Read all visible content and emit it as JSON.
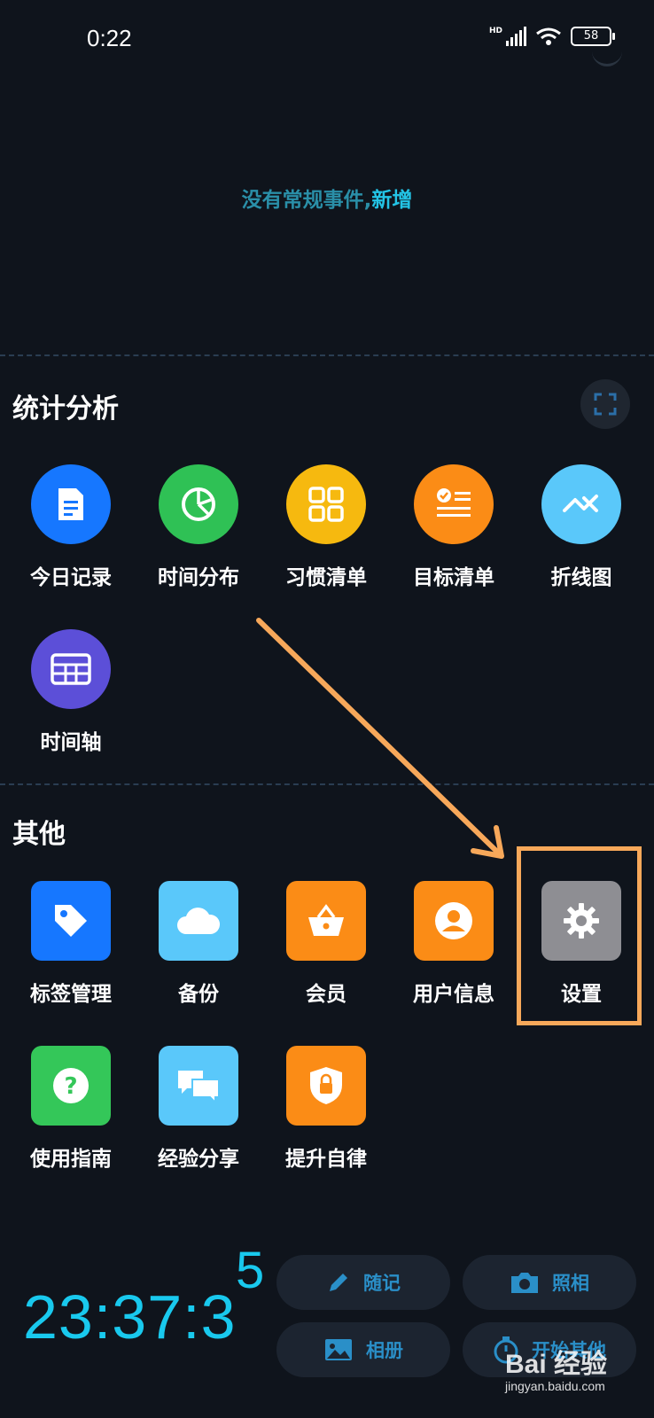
{
  "status": {
    "time": "0:22",
    "battery": "58",
    "network": "HD"
  },
  "routine": {
    "empty_text": "没有常规事件,",
    "add_link": "新增"
  },
  "stats": {
    "title": "统计分析",
    "items": [
      {
        "label": "今日记录",
        "icon": "document-icon",
        "color": "#1677ff"
      },
      {
        "label": "时间分布",
        "icon": "pie-chart-icon",
        "color": "#2fc155"
      },
      {
        "label": "习惯清单",
        "icon": "grid-icon",
        "color": "#f6b90f"
      },
      {
        "label": "目标清单",
        "icon": "checklist-icon",
        "color": "#fb8c16"
      },
      {
        "label": "折线图",
        "icon": "line-chart-icon",
        "color": "#5ac8fa"
      },
      {
        "label": "时间轴",
        "icon": "table-icon",
        "color": "#5c4fd8"
      }
    ]
  },
  "others": {
    "title": "其他",
    "items": [
      {
        "label": "标签管理",
        "icon": "tag-icon",
        "color": "#1677ff"
      },
      {
        "label": "备份",
        "icon": "cloud-icon",
        "color": "#5ac8fa"
      },
      {
        "label": "会员",
        "icon": "basket-icon",
        "color": "#fb8c16"
      },
      {
        "label": "用户信息",
        "icon": "user-icon",
        "color": "#fb8c16"
      },
      {
        "label": "设置",
        "icon": "gear-icon",
        "color": "#8e8e93"
      },
      {
        "label": "使用指南",
        "icon": "question-icon",
        "color": "#34c759"
      },
      {
        "label": "经验分享",
        "icon": "chat-icon",
        "color": "#5ac8fa"
      },
      {
        "label": "提升自律",
        "icon": "shield-lock-icon",
        "color": "#fb8c16"
      }
    ]
  },
  "clock": {
    "main": "23:37:3",
    "seconds_digit": "5"
  },
  "quick_actions": [
    {
      "label": "随记",
      "icon": "pencil-icon"
    },
    {
      "label": "照相",
      "icon": "camera-icon"
    },
    {
      "label": "相册",
      "icon": "image-icon"
    },
    {
      "label": "开始其他",
      "icon": "timer-icon"
    }
  ],
  "watermark": {
    "brand": "Bai 经验",
    "sub": "jingyan.baidu.com"
  },
  "colors": {
    "accent": "#19c9ee",
    "highlight": "#f7a85a",
    "background": "#0f141c"
  }
}
